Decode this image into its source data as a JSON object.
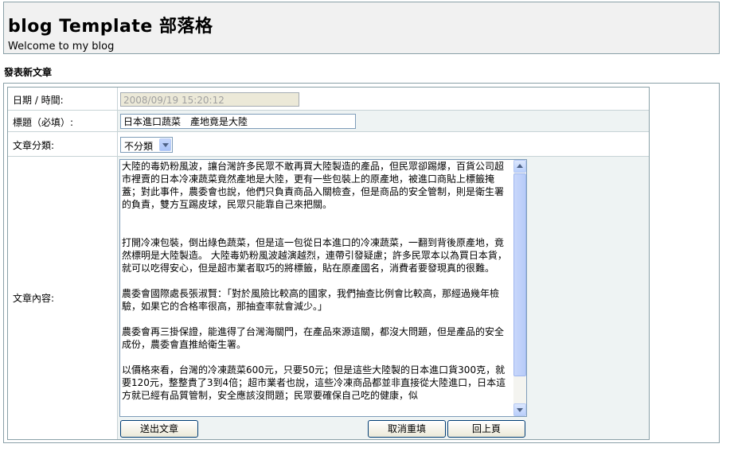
{
  "header": {
    "title": "blog Template 部落格",
    "subtitle": "Welcome to my blog"
  },
  "section_title": "發表新文章",
  "form": {
    "datetime": {
      "label": "日期 / 時間:",
      "value": "2008/09/19  15:20:12"
    },
    "subject": {
      "label": "標題（必填）:",
      "value": "日本進口蔬菜　產地竟是大陸"
    },
    "category": {
      "label": "文章分類:",
      "selected": "不分類"
    },
    "content": {
      "label": "文章內容:",
      "value": "大陸的毒奶粉風波，讓台灣許多民眾不敢再買大陸製造的產品，但民眾卻踢爆，百貨公司超市裡賣的日本冷凍蔬菜竟然產地是大陸，更有一些包裝上的原產地，被進口商貼上標籤掩蓋；對此事件，農委會也說，他們只負責商品入關檢查，但是商品的安全管制，則是衛生署的負責，雙方互踢皮球，民眾只能靠自己來把關。\n\n\n打開冷凍包裝，倒出綠色蔬菜，但是這一包從日本進口的冷凍蔬菜，一翻到背後原產地，竟然標明是大陸製造。 大陸毒奶粉風波越演越烈，連帶引發疑慮；許多民眾本以為買日本貨，就可以吃得安心，但是超市業者取巧的將標籤，貼在原產國名，消費者要發現真的很難。\n\n農委會國際處長張淑賢：「對於風險比較高的國家，我們抽查比例會比較高，那經過幾年檢驗，如果它的合格率很高，那抽查率就會減少。」\n\n農委會再三掛保證，能進得了台灣海關門，在產品來源這關，都沒大問題，但是產品的安全成份，農委會直推給衛生署。\n\n以價格來看，台灣的冷凍蔬菜600元，只要50元；但是這些大陸製的日本進口貨300克，就要120元，整整貴了3到4倍；超市業者也說，這些冷凍商品都並非直接從大陸進口，日本這方就已經有品質管制，安全應該沒問題；民眾要確保自己吃的健康，似"
    },
    "buttons": {
      "submit": "送出文章",
      "reset": "取消重填",
      "back": "回上頁"
    }
  }
}
